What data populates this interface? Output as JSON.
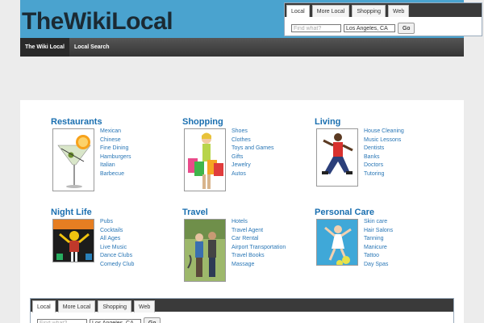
{
  "header": {
    "logo": "TheWikiLocal"
  },
  "search": {
    "tabs": [
      "Local",
      "More Local",
      "Shopping",
      "Web"
    ],
    "what_placeholder": "Find what?",
    "where_value": "Los Angeles, CA",
    "go_label": "Go"
  },
  "nav": {
    "items": [
      "The Wiki Local",
      "Local Search"
    ]
  },
  "categories": [
    {
      "title": "Restaurants",
      "links": [
        "Mexican",
        "Chinese",
        "Fine Dining",
        "Hamburgers",
        "Italian",
        "Barbecue"
      ]
    },
    {
      "title": "Shopping",
      "links": [
        "Shoes",
        "Clothes",
        "Toys and Games",
        "Gifts",
        "Jewelry",
        "Autos"
      ]
    },
    {
      "title": "Living",
      "links": [
        "House Cleaning",
        "Music Lessons",
        "Dentists",
        "Banks",
        "Doctors",
        "Tutoring"
      ]
    },
    {
      "title": "Night Life",
      "links": [
        "Pubs",
        "Cocktails",
        "All Ages",
        "Live Music",
        "Dance Clubs",
        "Comedy Club"
      ]
    },
    {
      "title": "Travel",
      "links": [
        "Hotels",
        "Travel Agent",
        "Car Rental",
        "Airport Transportation",
        "Travel Books",
        "Massage"
      ]
    },
    {
      "title": "Personal Care",
      "links": [
        "Skin care",
        "Hair Salons",
        "Tanning",
        "Manicure",
        "Tattoo",
        "Day Spas"
      ]
    }
  ],
  "bottom_search": {
    "tabs": [
      "Local",
      "More Local",
      "Shopping",
      "Web"
    ],
    "what_placeholder": "Find what?",
    "where_value": "Los Angeles, CA",
    "go_label": "Go"
  }
}
